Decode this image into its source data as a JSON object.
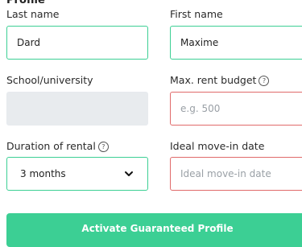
{
  "form": {
    "title": "Profile",
    "last_name": {
      "label": "Last name",
      "value": "Dard"
    },
    "first_name": {
      "label": "First name",
      "value": "Maxime"
    },
    "school": {
      "label": "School/university",
      "value": ""
    },
    "budget": {
      "label": "Max. rent budget",
      "placeholder": "e.g. 500"
    },
    "duration": {
      "label": "Duration of rental",
      "selected": "3 months"
    },
    "move_in": {
      "label": "Ideal move-in date",
      "placeholder": "Ideal move-in date"
    },
    "help_icon": "?",
    "submit_label": "Activate Guaranteed Profile"
  },
  "icons": {
    "help": "question-circle-icon",
    "chevron": "chevron-down-icon"
  },
  "colors": {
    "accent": "#3ccf94",
    "error": "#e06a6a",
    "disabled_bg": "#e8ebee"
  }
}
